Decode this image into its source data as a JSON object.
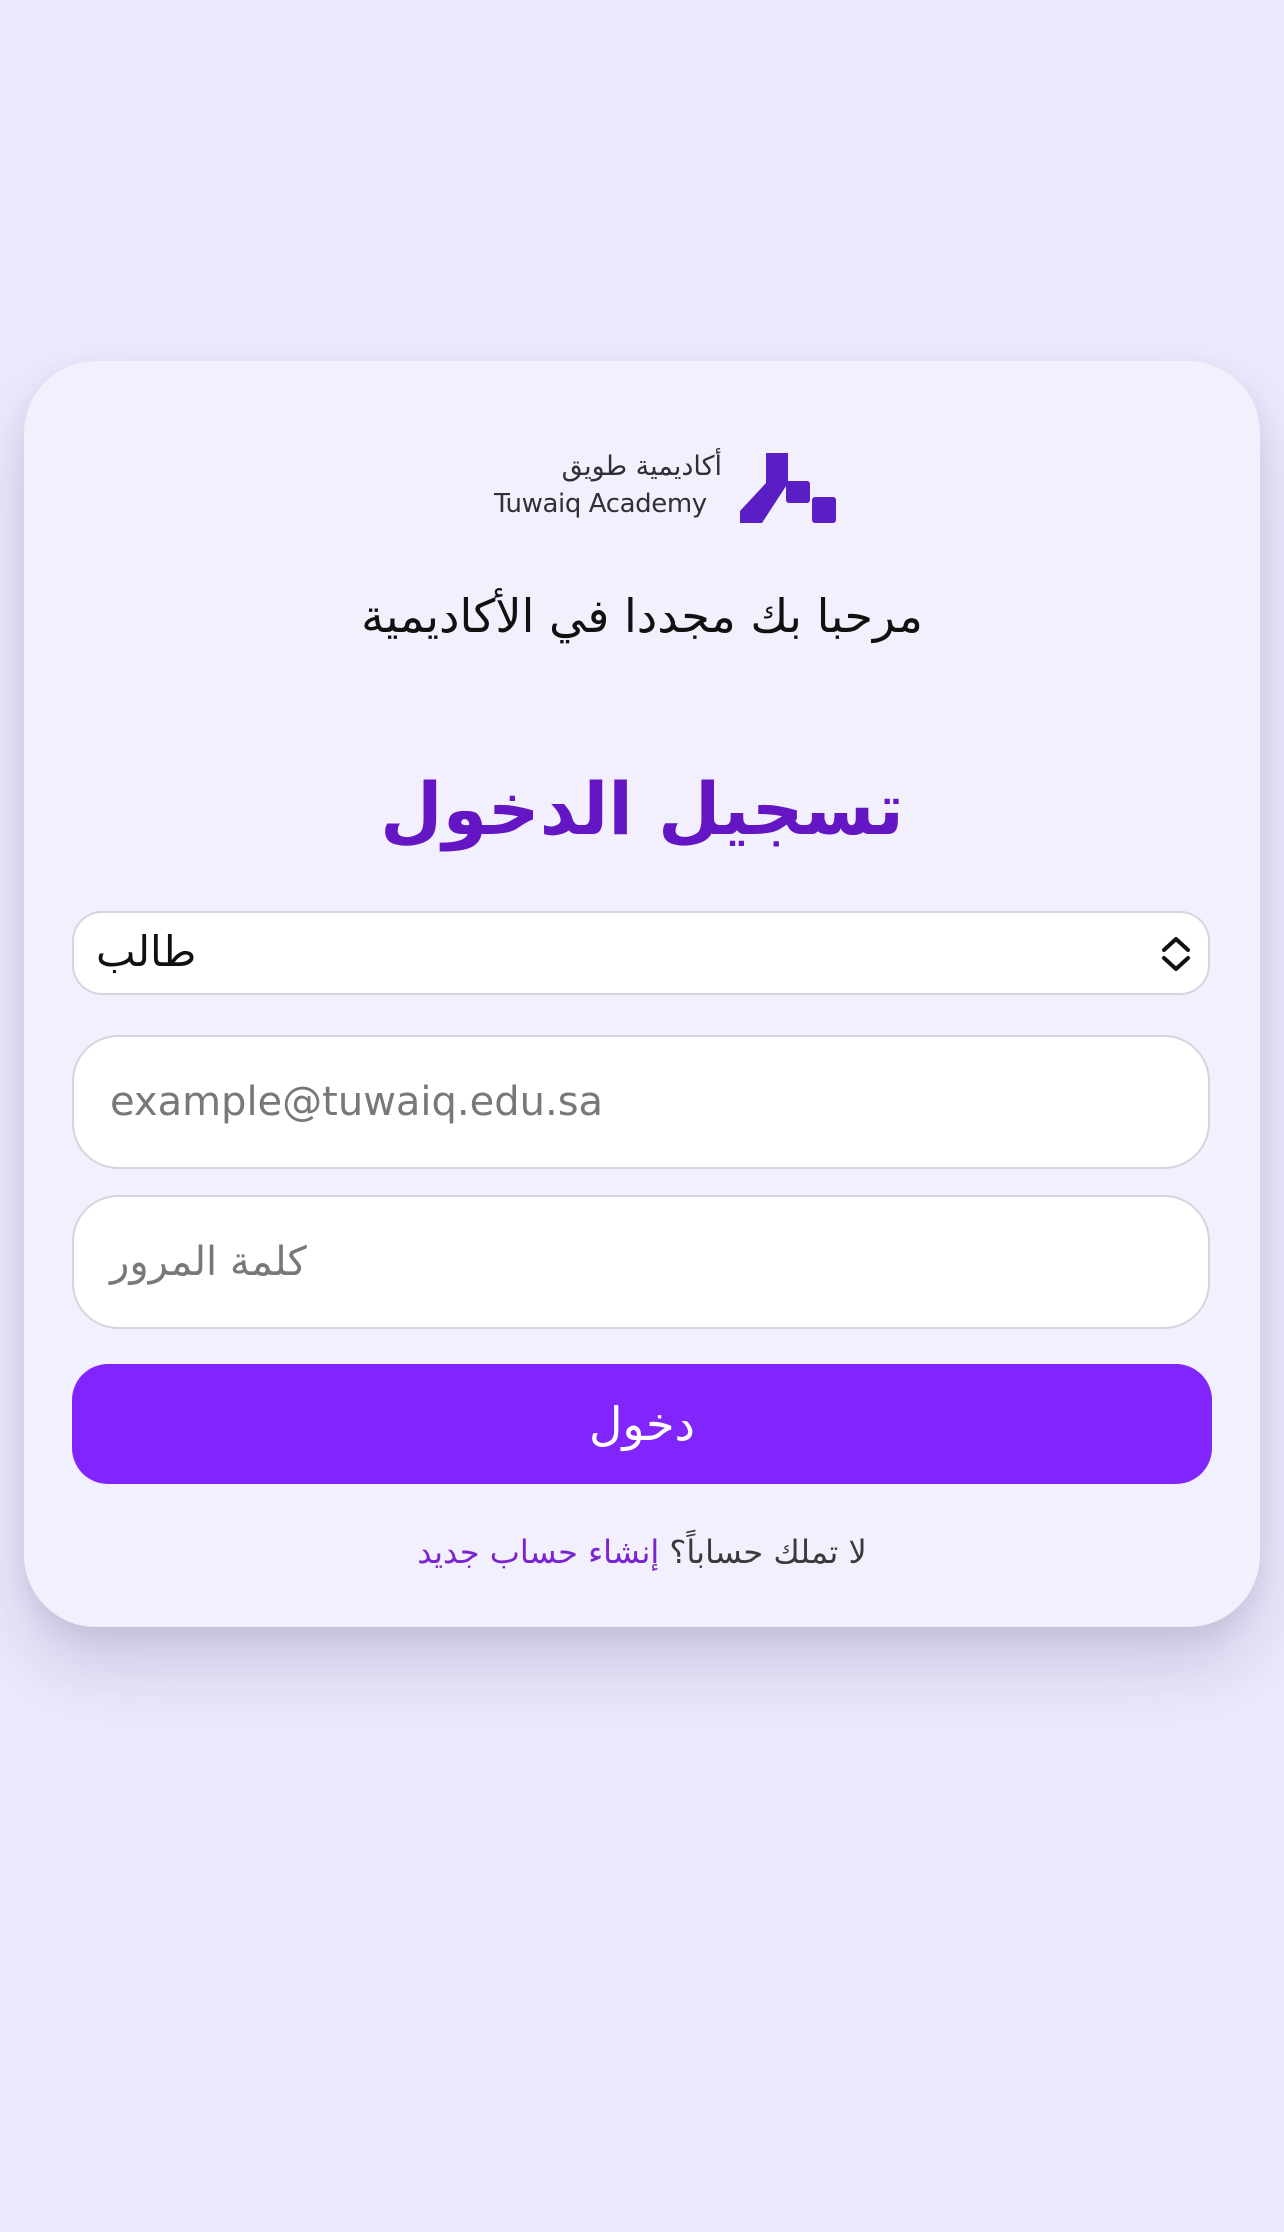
{
  "logo": {
    "ar_text": "أكاديمية طويق",
    "en_text": "Tuwaiq Academy",
    "icon": "tuwaiq-mark-icon",
    "color": "#5a1fc4"
  },
  "welcome_text": "مرحبا بك مجددا في الأكاديمية",
  "title": "تسجيل الدخول",
  "role_select": {
    "selected": "طالب",
    "icon": "chevron-up-down-icon"
  },
  "email_field": {
    "placeholder": "example@tuwaiq.edu.sa"
  },
  "password_field": {
    "placeholder": "كلمة المرور"
  },
  "submit_label": "دخول",
  "signup": {
    "prompt": "لا تملك حساباً؟",
    "link": "إنشاء حساب جديد"
  },
  "colors": {
    "page_bg": "#ece9fd",
    "card_bg": "#f3f0fd",
    "accent": "#8125fd",
    "title": "#6415c4",
    "link": "#7a24d1"
  }
}
